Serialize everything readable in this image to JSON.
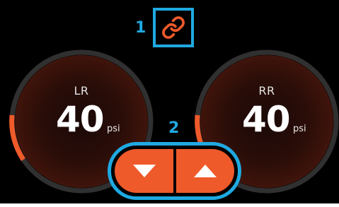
{
  "accent_color": "#ef5a2b",
  "callout_color": "#1fa9e1",
  "link_icon": "link-icon",
  "callouts": {
    "one": "1",
    "two": "2"
  },
  "gauges": [
    {
      "label": "LR",
      "value": "40",
      "unit": "psi"
    },
    {
      "label": "RR",
      "value": "40",
      "unit": "psi"
    }
  ],
  "stepper": {
    "down_icon": "triangle-down-icon",
    "up_icon": "triangle-up-icon"
  }
}
